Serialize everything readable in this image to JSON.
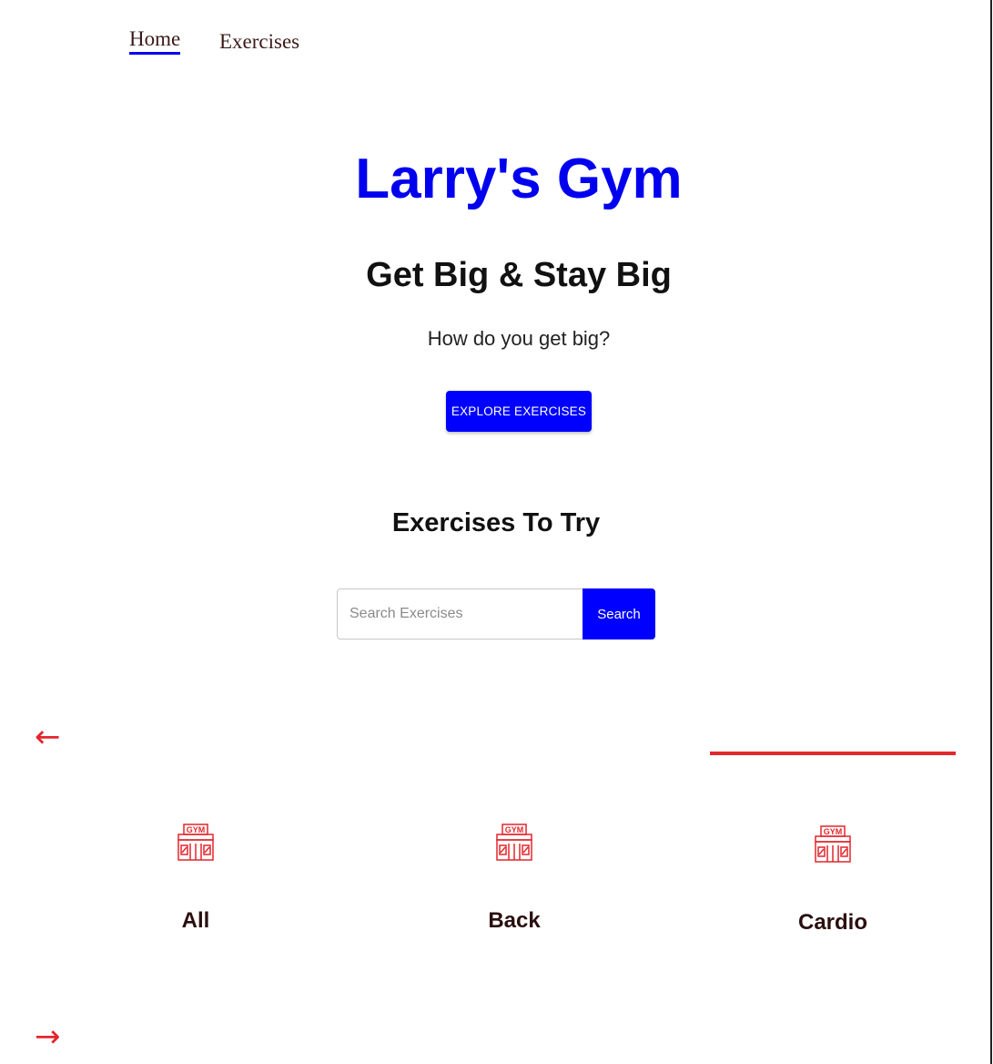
{
  "nav": {
    "items": [
      {
        "label": "Home"
      },
      {
        "label": "Exercises"
      }
    ]
  },
  "hero": {
    "title": "Larry's Gym",
    "tagline": "Get Big & Stay Big",
    "question": "How do you get big?",
    "cta_label": "EXPLORE EXERCISES"
  },
  "exercises": {
    "heading": "Exercises To Try",
    "search": {
      "placeholder": "Search Exercises",
      "value": "",
      "button_label": "Search"
    }
  },
  "carousel": {
    "prev_arrow": "←",
    "next_arrow": "→",
    "categories": [
      {
        "label": "All",
        "icon": "gym-icon"
      },
      {
        "label": "Back",
        "icon": "gym-icon"
      },
      {
        "label": "Cardio",
        "icon": "gym-icon"
      }
    ]
  },
  "colors": {
    "brand_blue": "#0000ff",
    "accent_red": "#e3262c"
  }
}
